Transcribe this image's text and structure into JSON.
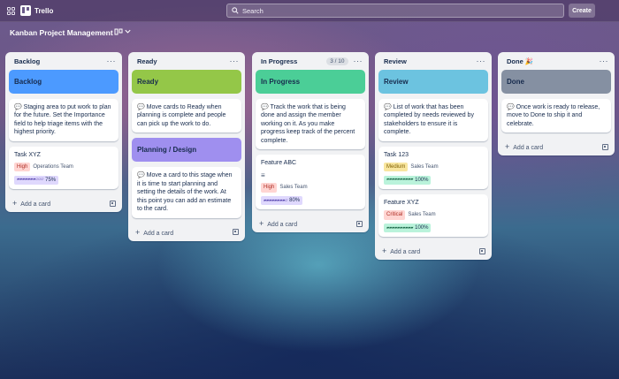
{
  "topbar": {
    "app_name": "Trello",
    "search_placeholder": "Search",
    "create_label": "Create"
  },
  "board": {
    "title": "Kanban Project Management"
  },
  "lists": {
    "backlog": {
      "title": "Backlog",
      "cover_title": "Backlog",
      "cover_color": "#4c9aff",
      "description": "💬 Staging area to put work to plan for the future. Set the Importance field to help triage items with the highest priority.",
      "cards": [
        {
          "title": "Task XYZ",
          "label": "High",
          "team": "Operations Team",
          "progress_bar": "▰▰▰▰▰▰▰▱▱▱",
          "progress": "75%"
        }
      ],
      "add_label": "Add a card"
    },
    "ready": {
      "title": "Ready",
      "cover_title": "Ready",
      "cover_color": "#94c748",
      "description": "💬 Move cards to Ready when planning is complete and people can pick up the work to do.",
      "cover2_title": "Planning / Design",
      "cover2_color": "#9f8fef",
      "description2": "💬 Move a card to this stage when it is time to start planning and setting the details of the work. At this point you can add an estimate to the card.",
      "add_label": "Add a card"
    },
    "in_progress": {
      "title": "In Progress",
      "wip": "3 / 10",
      "cover_title": "In Progress",
      "cover_color": "#4bce97",
      "description": "💬 Track the work that is being done and assign the member working on it. As you make progress keep track of the percent complete.",
      "cards": [
        {
          "title": "Feature ABC",
          "label": "High",
          "team": "Sales Team",
          "progress_bar": "▰▰▰▰▰▰▰▰▱",
          "progress": "80%"
        }
      ],
      "add_label": "Add a card"
    },
    "review": {
      "title": "Review",
      "cover_title": "Review",
      "cover_color": "#6cc3e0",
      "description": "💬 List of work that has been completed by needs reviewed by stakeholders to ensure it is complete.",
      "cards": [
        {
          "title": "Task 123",
          "label": "Medium",
          "team": "Sales Team",
          "progress_bar": "▰▰▰▰▰▰▰▰▰▰",
          "progress": "100%"
        },
        {
          "title": "Feature XYZ",
          "label": "Critical",
          "team": "Sales Team",
          "progress_bar": "▰▰▰▰▰▰▰▰▰▰",
          "progress": "100%"
        }
      ],
      "add_label": "Add a card"
    },
    "done": {
      "title": "Done 🎉",
      "cover_title": "Done",
      "cover_color": "#8590a2",
      "description": "💬 Once work is ready to release, move to Done to ship it and celebrate.",
      "add_label": "Add a card"
    }
  },
  "colors": {
    "label_high_bg": "#ffd5d2",
    "label_high_fg": "#ae2e24",
    "label_medium_bg": "#f8e6a0",
    "label_critical_bg": "#ffd5d2",
    "progress_violet_bg": "#dfd8fd",
    "progress_green_bg": "#baf3db"
  }
}
